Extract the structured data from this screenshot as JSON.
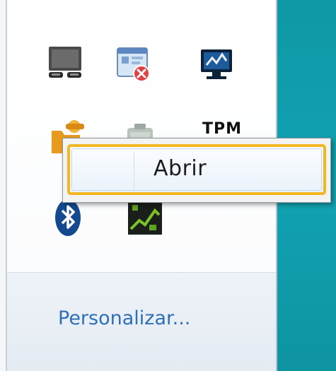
{
  "tray_icons": [
    {
      "name": "display-device-icon"
    },
    {
      "name": "action-center-error-icon"
    },
    {
      "name": "network-monitor-icon"
    },
    {
      "name": "user-folder-icon"
    },
    {
      "name": "battery-icon"
    },
    {
      "name": "tpm-icon",
      "label": "TPM"
    },
    {
      "name": "bluetooth-icon"
    },
    {
      "name": "security-app-icon"
    }
  ],
  "context_menu": {
    "open_label": "Abrir"
  },
  "footer": {
    "customize_label": "Personalizar..."
  },
  "colors": {
    "highlight_border": "#f2b722",
    "link": "#2e6fb6",
    "desktop": "#12a3b1"
  }
}
